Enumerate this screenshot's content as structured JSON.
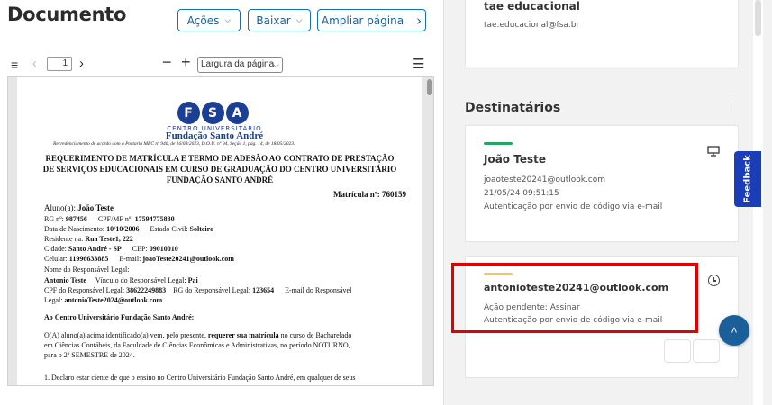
{
  "header": {
    "title": "Documento",
    "acoes_label": "Ações",
    "baixar_label": "Baixar",
    "ampliar_label": "Ampliar página"
  },
  "toolbar": {
    "page_value": "1",
    "zoom_selected": "Largura da página"
  },
  "pdf": {
    "logo_letters": [
      "F",
      "S",
      "A"
    ],
    "logo_sub": "CENTRO UNIVERSITÁRIO",
    "logo_main": "Fundação Santo André",
    "recred": "Recredenciamento de acordo com a Portaria MEC nº 946, de 16/08/2023, D.O.U. nº 94, Seção 1, pág. 14, de 18/05/2023.",
    "title_l1": "REQUERIMENTO DE MATRÍCULA E TERMO DE ADESÃO AO CONTRATO DE PRESTAÇÃO",
    "title_l2": "DE SERVIÇOS EDUCACIONAIS EM CURSO DE GRADUAÇÃO DO CENTRO UNIVERSITÁRIO",
    "title_l3": "FUNDAÇÃO SANTO ANDRÉ",
    "matricula_label": "Matrícula nº:",
    "matricula_value": "760159",
    "aluno_label": "Aluno(a):",
    "aluno_value": "João Teste",
    "rg_label": "RG nº:",
    "rg_value": "987456",
    "cpf_label": "CPF/MF nº:",
    "cpf_value": "17594775830",
    "nasc_label": "Data de Nascimento:",
    "nasc_value": "10/10/2006",
    "civil_label": "Estado Civil:",
    "civil_value": "Solteiro",
    "resid_label": "Residente na:",
    "resid_value": "Rua Teste1, 222",
    "cidade_label": "Cidade:",
    "cidade_value": "Santo André - SP",
    "cep_label": "CEP:",
    "cep_value": "09010010",
    "cel_label": "Celular:",
    "cel_value": "11996633885",
    "email_label": "E-mail:",
    "email_value": "joaoTeste20241@outlook.com",
    "resp_label": "Nome do Responsável Legal:",
    "resp_name": "Antonio Teste",
    "vinculo_label": "Vínculo do Responsável Legal:",
    "vinculo_value": "Pai",
    "cpf_resp_label": "CPF do Responsável Legal:",
    "cpf_resp_value": "38622249883",
    "rg_resp_label": "RG do Responsável Legal:",
    "rg_resp_value": "123654",
    "email_resp_label": "E-mail do Responsável",
    "email_resp_label2": "Legal:",
    "email_resp_value": "antonioTeste2024@outlook.com",
    "ao_centro": "Ao Centro Universitário Fundação Santo André:",
    "p1a": "O(A) aluno(a) acima identificado(a) vem, pelo presente,",
    "p1b": "requerer sua matrícula",
    "p1c": "no curso de Bacharelado",
    "p2": "em Ciências Contábeis, da Faculdade de Ciências Econômicas e Administrativas, no período NOTURNO,",
    "p3": "para o 2º SEMESTRE de 2024.",
    "p4": "1. Declaro estar ciente de que o ensino no Centro Universitário Fundação Santo André, em qualquer de seus"
  },
  "sidebar": {
    "top_name": "tae educacional",
    "top_email": "tae.educacional@fsa.br",
    "dest_title": "Destinatários",
    "recipients": [
      {
        "name": "João Teste",
        "email": "joaoteste20241@outlook.com",
        "datetime": "21/05/24 09:51:15",
        "auth": "Autenticação por envio de código via e-mail",
        "status_color": "#26a65b",
        "icon": "monitor-icon"
      },
      {
        "name": "antonioteste20241@outlook.com",
        "pending": "Ação pendente: Assinar",
        "auth": "Autenticação por envio de código via e-mail",
        "status_color": "#f2c94c",
        "icon": "clock-icon"
      }
    ]
  },
  "feedback_label": "Feedback",
  "colors": {
    "accent": "#1a5f99",
    "highlight": "#e00000",
    "feedback": "#1c3db8"
  }
}
